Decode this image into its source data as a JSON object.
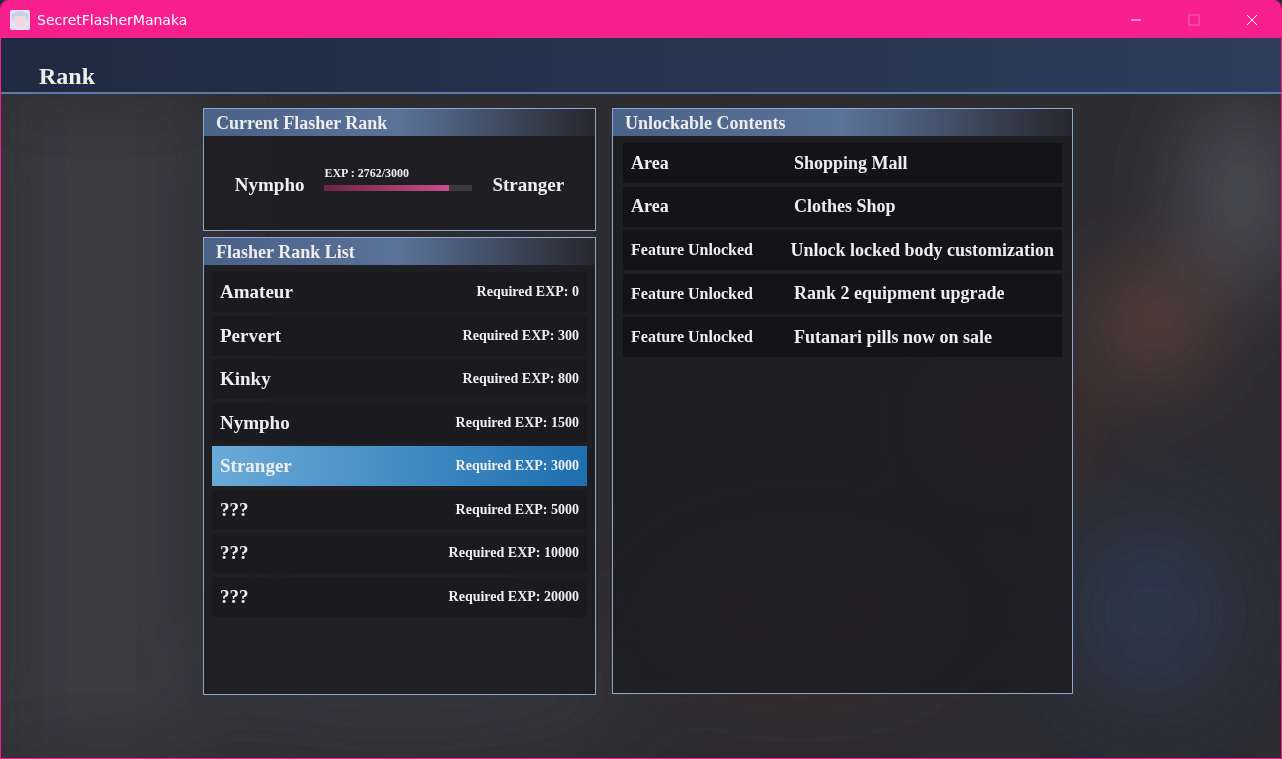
{
  "window": {
    "title": "SecretFlasherManaka",
    "maximize_enabled": false
  },
  "header": {
    "title": "Rank"
  },
  "current_rank": {
    "title": "Current Flasher Rank",
    "current": "Nympho",
    "next": "Stranger",
    "exp_label": "EXP : 2762/3000",
    "level": 0.84
  },
  "rank_list": {
    "title": "Flasher Rank List",
    "rows": [
      {
        "name": "Amateur",
        "requirement": "Required EXP: 0",
        "selected": false
      },
      {
        "name": "Pervert",
        "requirement": "Required EXP: 300",
        "selected": false
      },
      {
        "name": "Kinky",
        "requirement": "Required EXP: 800",
        "selected": false
      },
      {
        "name": "Nympho",
        "requirement": "Required EXP: 1500",
        "selected": false
      },
      {
        "name": "Stranger",
        "requirement": "Required EXP: 3000",
        "selected": true
      },
      {
        "name": "???",
        "requirement": "Required EXP: 5000",
        "selected": false
      },
      {
        "name": "???",
        "requirement": "Required EXP: 10000",
        "selected": false
      },
      {
        "name": "???",
        "requirement": "Required EXP: 20000",
        "selected": false
      }
    ]
  },
  "unlockables": {
    "title": "Unlockable Contents",
    "rows": [
      {
        "kind": "area",
        "type": "Area",
        "content": "Shopping Mall"
      },
      {
        "kind": "area",
        "type": "Area",
        "content": "Clothes Shop"
      },
      {
        "kind": "feature",
        "type": "Feature Unlocked",
        "content": "Unlock locked body customization"
      },
      {
        "kind": "feature",
        "type": "Feature Unlocked",
        "content": "Rank 2 equipment upgrade"
      },
      {
        "kind": "feature",
        "type": "Feature Unlocked",
        "content": "Futanari pills now on sale"
      }
    ]
  }
}
